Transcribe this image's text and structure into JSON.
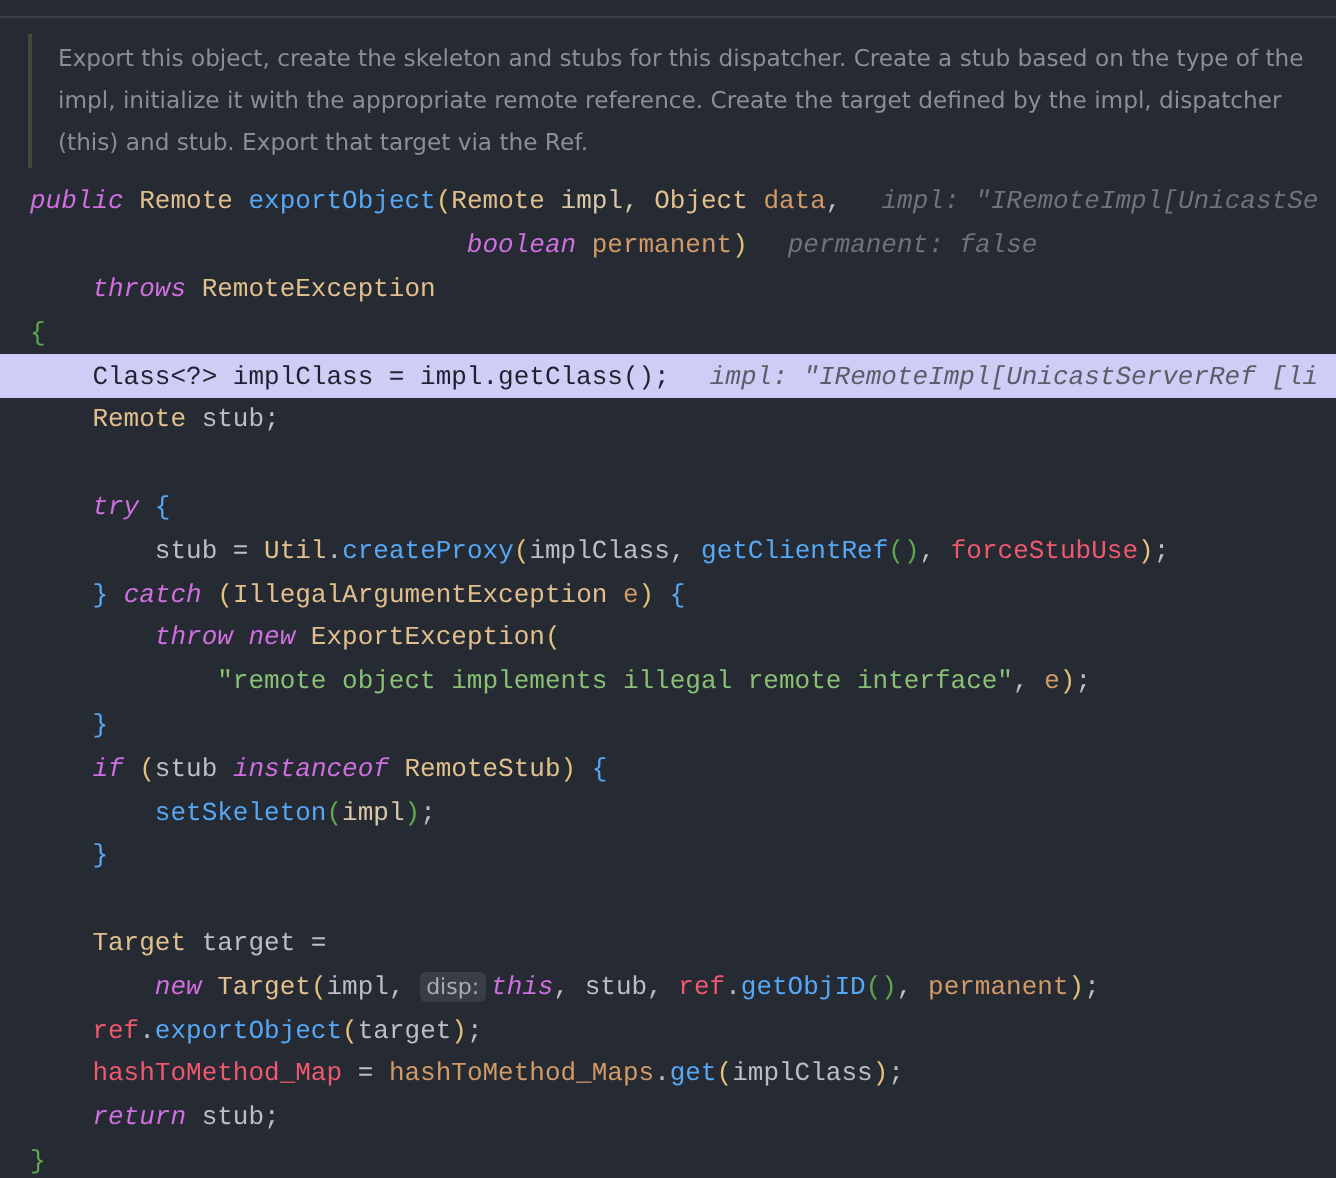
{
  "doc_comment": "Export this object, create the skeleton and stubs for this dispatcher. Create a stub based on the type of the impl, initialize it with the appropriate remote reference. Create the target defined by the impl, dispatcher (this) and stub. Export that target via the Ref.",
  "code_lines": [
    {
      "kind": "code",
      "highlighted": false,
      "tokens": [
        {
          "text": "public",
          "kind": "keyword"
        },
        {
          "text": " Remote ",
          "kind": "type"
        },
        {
          "text": "exportObject",
          "kind": "method"
        },
        {
          "text": "(",
          "kind": "brace1"
        },
        {
          "text": "Remote ",
          "kind": "type"
        },
        {
          "text": "impl, ",
          "kind": "local"
        },
        {
          "text": "Object ",
          "kind": "type"
        },
        {
          "text": "data",
          "kind": "param"
        },
        {
          "text": ",",
          "kind": "plain"
        },
        {
          "text": "impl: \"IRemoteImpl[UnicastSe",
          "kind": "hint"
        }
      ]
    },
    {
      "kind": "code",
      "highlighted": false,
      "tokens": [
        {
          "text": "                            boolean",
          "kind": "keyword"
        },
        {
          "text": " permanent",
          "kind": "param"
        },
        {
          "text": ")",
          "kind": "brace1"
        },
        {
          "text": "permanent: false",
          "kind": "hint"
        }
      ]
    },
    {
      "kind": "code",
      "highlighted": false,
      "tokens": [
        {
          "text": "    throws",
          "kind": "keyword"
        },
        {
          "text": " RemoteException",
          "kind": "type"
        }
      ]
    },
    {
      "kind": "code",
      "highlighted": false,
      "tokens": [
        {
          "text": "{",
          "kind": "brace2"
        }
      ]
    },
    {
      "kind": "code",
      "highlighted": true,
      "tokens": [
        {
          "text": "    Class<?> implClass = impl.getClass();",
          "kind": "plain"
        },
        {
          "text": "impl: \"IRemoteImpl[UnicastServerRef [li",
          "kind": "hint"
        }
      ]
    },
    {
      "kind": "code",
      "highlighted": false,
      "tokens": [
        {
          "text": "    Remote",
          "kind": "type"
        },
        {
          "text": " stub;",
          "kind": "plain"
        }
      ]
    },
    {
      "kind": "blank",
      "highlighted": false
    },
    {
      "kind": "code",
      "highlighted": false,
      "tokens": [
        {
          "text": "    try",
          "kind": "keyword"
        },
        {
          "text": " {",
          "kind": "brace3"
        }
      ]
    },
    {
      "kind": "code",
      "highlighted": false,
      "tokens": [
        {
          "text": "        stub = ",
          "kind": "plain"
        },
        {
          "text": "Util",
          "kind": "type"
        },
        {
          "text": ".",
          "kind": "plain"
        },
        {
          "text": "createProxy",
          "kind": "method"
        },
        {
          "text": "(",
          "kind": "brace1"
        },
        {
          "text": "implClass, ",
          "kind": "plain"
        },
        {
          "text": "getClientRef",
          "kind": "method"
        },
        {
          "text": "()",
          "kind": "brace2"
        },
        {
          "text": ", ",
          "kind": "plain"
        },
        {
          "text": "forceStubUse",
          "kind": "field"
        },
        {
          "text": ")",
          "kind": "brace1"
        },
        {
          "text": ";",
          "kind": "plain"
        }
      ]
    },
    {
      "kind": "code",
      "highlighted": false,
      "tokens": [
        {
          "text": "    }",
          "kind": "brace3"
        },
        {
          "text": " catch",
          "kind": "keyword"
        },
        {
          "text": " (",
          "kind": "brace1"
        },
        {
          "text": "IllegalArgumentException",
          "kind": "type"
        },
        {
          "text": " e",
          "kind": "param"
        },
        {
          "text": ")",
          "kind": "brace1"
        },
        {
          "text": " {",
          "kind": "brace3"
        }
      ]
    },
    {
      "kind": "code",
      "highlighted": false,
      "tokens": [
        {
          "text": "        throw new",
          "kind": "keyword"
        },
        {
          "text": " ExportException",
          "kind": "type"
        },
        {
          "text": "(",
          "kind": "brace1"
        }
      ]
    },
    {
      "kind": "code",
      "highlighted": false,
      "tokens": [
        {
          "text": "            \"remote object implements illegal remote interface\"",
          "kind": "string"
        },
        {
          "text": ", ",
          "kind": "plain"
        },
        {
          "text": "e",
          "kind": "param"
        },
        {
          "text": ")",
          "kind": "brace1"
        },
        {
          "text": ";",
          "kind": "plain"
        }
      ]
    },
    {
      "kind": "code",
      "highlighted": false,
      "tokens": [
        {
          "text": "    }",
          "kind": "brace3"
        }
      ]
    },
    {
      "kind": "code",
      "highlighted": false,
      "tokens": [
        {
          "text": "    if",
          "kind": "keyword"
        },
        {
          "text": " (",
          "kind": "brace1"
        },
        {
          "text": "stub ",
          "kind": "plain"
        },
        {
          "text": "instanceof",
          "kind": "keyword"
        },
        {
          "text": " RemoteStub",
          "kind": "type"
        },
        {
          "text": ")",
          "kind": "brace1"
        },
        {
          "text": " {",
          "kind": "brace3"
        }
      ]
    },
    {
      "kind": "code",
      "highlighted": false,
      "tokens": [
        {
          "text": "        setSkeleton",
          "kind": "method"
        },
        {
          "text": "(",
          "kind": "brace2"
        },
        {
          "text": "impl",
          "kind": "local"
        },
        {
          "text": ")",
          "kind": "brace2"
        },
        {
          "text": ";",
          "kind": "plain"
        }
      ]
    },
    {
      "kind": "code",
      "highlighted": false,
      "tokens": [
        {
          "text": "    }",
          "kind": "brace3"
        }
      ]
    },
    {
      "kind": "blank",
      "highlighted": false
    },
    {
      "kind": "code",
      "highlighted": false,
      "tokens": [
        {
          "text": "    Target",
          "kind": "type"
        },
        {
          "text": " target =",
          "kind": "plain"
        }
      ]
    },
    {
      "kind": "code",
      "highlighted": false,
      "tokens": [
        {
          "text": "        new",
          "kind": "keyword"
        },
        {
          "text": " Target",
          "kind": "type"
        },
        {
          "text": "(",
          "kind": "brace1"
        },
        {
          "text": "impl, ",
          "kind": "plain"
        },
        {
          "text": "disp:",
          "kind": "inlay"
        },
        {
          "text": "this",
          "kind": "keyword"
        },
        {
          "text": ", stub, ",
          "kind": "plain"
        },
        {
          "text": "ref",
          "kind": "field"
        },
        {
          "text": ".",
          "kind": "plain"
        },
        {
          "text": "getObjID",
          "kind": "method"
        },
        {
          "text": "()",
          "kind": "brace2"
        },
        {
          "text": ", ",
          "kind": "plain"
        },
        {
          "text": "permanent",
          "kind": "param"
        },
        {
          "text": ")",
          "kind": "brace1"
        },
        {
          "text": ";",
          "kind": "plain"
        }
      ]
    },
    {
      "kind": "code",
      "highlighted": false,
      "tokens": [
        {
          "text": "    ref",
          "kind": "field"
        },
        {
          "text": ".",
          "kind": "plain"
        },
        {
          "text": "exportObject",
          "kind": "method"
        },
        {
          "text": "(",
          "kind": "brace1"
        },
        {
          "text": "target",
          "kind": "plain"
        },
        {
          "text": ")",
          "kind": "brace1"
        },
        {
          "text": ";",
          "kind": "plain"
        }
      ]
    },
    {
      "kind": "code",
      "highlighted": false,
      "tokens": [
        {
          "text": "    hashToMethod_Map",
          "kind": "field"
        },
        {
          "text": " = ",
          "kind": "plain"
        },
        {
          "text": "hashToMethod_Maps",
          "kind": "param"
        },
        {
          "text": ".",
          "kind": "plain"
        },
        {
          "text": "get",
          "kind": "method"
        },
        {
          "text": "(",
          "kind": "brace1"
        },
        {
          "text": "implClass",
          "kind": "plain"
        },
        {
          "text": ")",
          "kind": "brace1"
        },
        {
          "text": ";",
          "kind": "plain"
        }
      ]
    },
    {
      "kind": "code",
      "highlighted": false,
      "tokens": [
        {
          "text": "    return",
          "kind": "keyword"
        },
        {
          "text": " stub;",
          "kind": "plain"
        }
      ]
    },
    {
      "kind": "code",
      "highlighted": false,
      "tokens": [
        {
          "text": "}",
          "kind": "brace2"
        }
      ]
    }
  ]
}
